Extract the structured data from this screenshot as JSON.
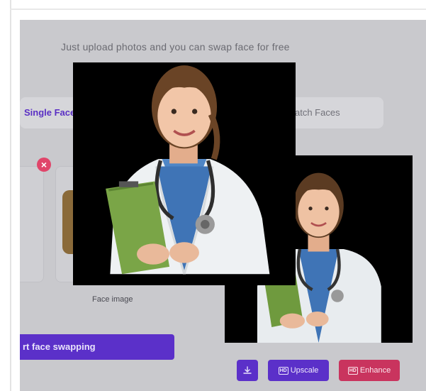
{
  "header": {
    "subtitle": "Just upload photos and you can swap face for free"
  },
  "mode_tabs": {
    "single": "Single Face",
    "batch": "atch Faces"
  },
  "upload": {
    "face_label": "Face image"
  },
  "actions": {
    "start_label": "rt face swapping",
    "upscale_label": "Upscale",
    "enhance_label": "Enhance",
    "hd_badge": "HD"
  },
  "icons": {
    "close": "close-icon",
    "download": "download-icon",
    "hd": "hd-icon"
  },
  "colors": {
    "primary": "#5b30c9",
    "danger": "#c9345e",
    "overlay": "#c9c9cd",
    "badge": "#e0456a"
  }
}
